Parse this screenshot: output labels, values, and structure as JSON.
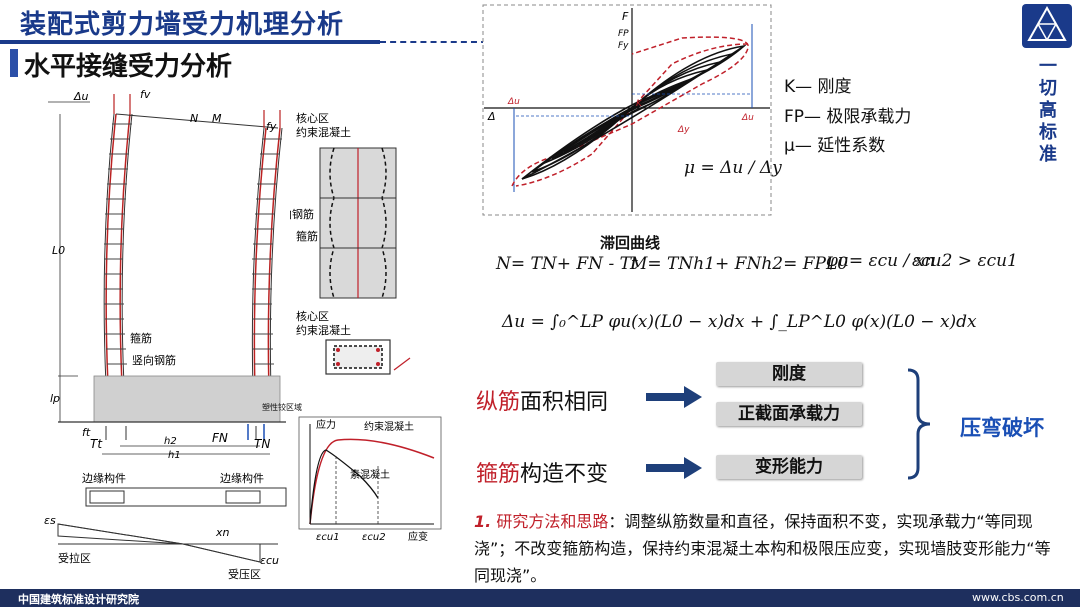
{
  "header": {
    "title": "装配式剪力墙受力机理分析",
    "subtitle": "水平接缝受力分析",
    "logo_text": "一切高标准"
  },
  "wall_figure": {
    "labels": {
      "delta_u": "Δu",
      "fv": "fv",
      "fy": "fy",
      "N": "N",
      "M": "M",
      "L0": "L0",
      "lp": "lp",
      "stirrup": "箍筋",
      "vertical_rebar": "竖向钢筋",
      "ft": "ft",
      "Tt": "Tt",
      "FN": "FN",
      "TN": "TN",
      "h1": "h1",
      "h2": "h2",
      "boundary_left": "边缘构件",
      "boundary_right": "边缘构件",
      "eps_s": "εs",
      "xn": "xn",
      "eps_cu": "εcu",
      "tension_zone": "受拉区",
      "compression_zone": "受压区"
    }
  },
  "core_figure": {
    "labels": {
      "core": "核心区",
      "confined": "约束混凝土",
      "vertical_rebar": "竖向钢筋",
      "stirrup": "箍筋",
      "core2": "核心区",
      "confined2": "约束混凝土",
      "plastic": "塑性铰区域"
    }
  },
  "stress_strain": {
    "ylabel": "应力",
    "xlabel": "应变",
    "confined_label": "约束混凝土",
    "plain_label": "素混凝土",
    "eps1": "εcu1",
    "eps2": "εcu2"
  },
  "hysteresis": {
    "caption": "滞回曲线",
    "labels": {
      "F": "F",
      "FP": "FP",
      "Fy": "Fy",
      "delta": "Δ",
      "du": "Δu",
      "dy": "Δy",
      "K": "K"
    }
  },
  "legend": {
    "k": "K— 刚度",
    "fp": "FP— 极限承载力",
    "mu": "μ— 延性系数"
  },
  "formulas": {
    "mu_eq": "μ = Δu / Δy",
    "N_eq": "N= TN+ FN - Tt",
    "M_eq": "M= TNh1+ FNh2= FPL0",
    "phi_eq": "φu= εcu / xn",
    "eps_cmp": "εcu2 > εcu1",
    "delta_eq": "Δu = ∫₀^LP φu(x)(L0 − x)dx + ∫_LP^L0 φ(x)(L0 − x)dx"
  },
  "comparison": {
    "row1_red": "纵筋",
    "row1_rest": "面积相同",
    "row2_red": "箍筋",
    "row2_rest": "构造不变",
    "box1": "刚度",
    "box2": "正截面承载力",
    "box3": "变形能力",
    "conclusion": "压弯破坏"
  },
  "note": {
    "num": "1.",
    "head": "研究方法和思路",
    "body": "：调整纵筋数量和直径，保持面积不变，实现承载力“等同现浇”；不改变箍筋构造，保持约束混凝土本构和极限压应变，实现墙肢变形能力“等同现浇”。"
  },
  "footer": {
    "left": "中国建筑标准设计研究院",
    "right": "www.cbs.com.cn"
  },
  "colors": {
    "brand": "#1a3a8a",
    "accent_red": "#c0202a",
    "conclusion_blue": "#1a4fb5"
  }
}
